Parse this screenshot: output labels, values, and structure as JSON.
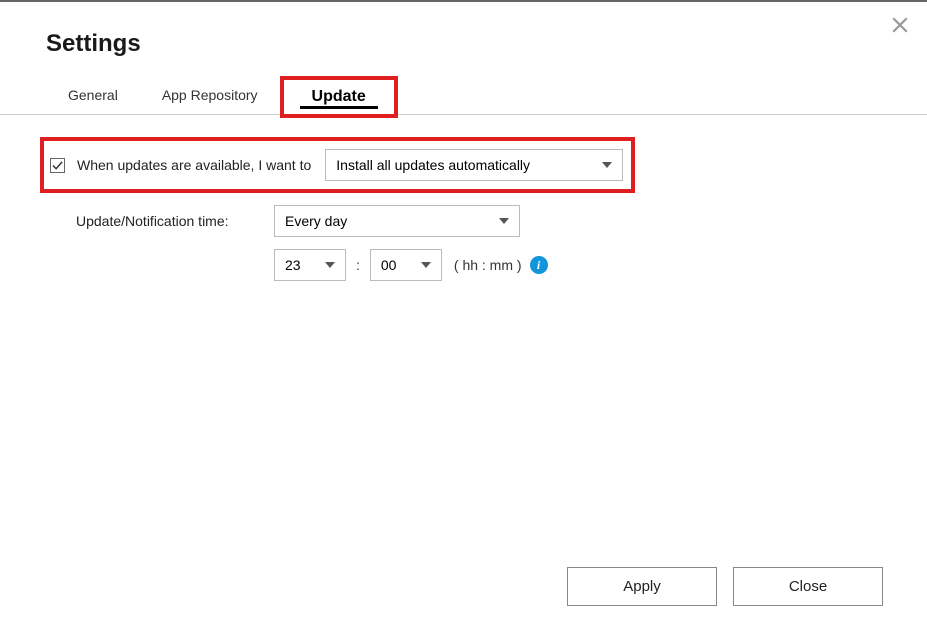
{
  "dialog": {
    "title": "Settings"
  },
  "tabs": {
    "general": "General",
    "app_repository": "App Repository",
    "update": "Update",
    "active": "update"
  },
  "update_settings": {
    "checkbox_checked": true,
    "when_updates_label": "When updates are available, I want to",
    "action_select": "Install all updates automatically",
    "notification_time_label": "Update/Notification time:",
    "frequency_select": "Every day",
    "hour_select": "23",
    "minute_select": "00",
    "time_format_hint": "( hh : mm )",
    "colon": ":"
  },
  "footer": {
    "apply": "Apply",
    "close": "Close"
  },
  "icons": {
    "info": "i"
  }
}
